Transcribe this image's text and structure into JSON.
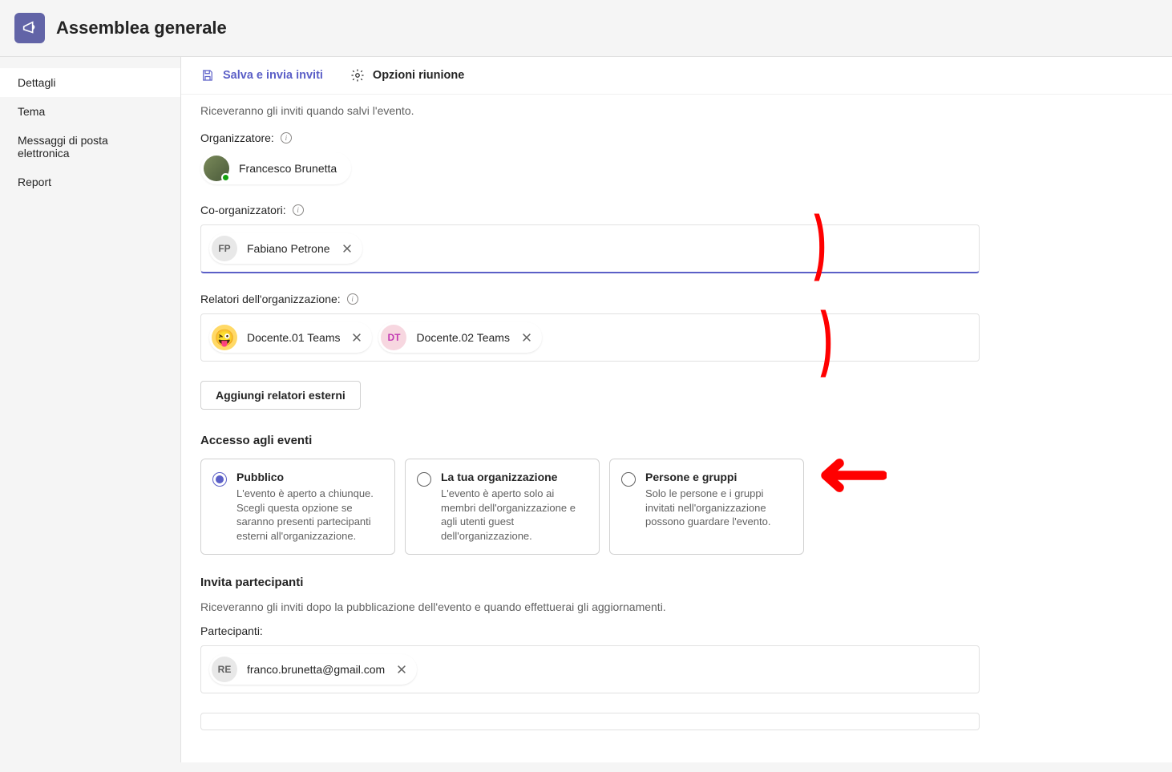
{
  "header": {
    "title": "Assemblea generale"
  },
  "sidebar": {
    "items": [
      {
        "label": "Dettagli",
        "active": true
      },
      {
        "label": "Tema",
        "active": false
      },
      {
        "label": "Messaggi di posta elettronica",
        "active": false
      },
      {
        "label": "Report",
        "active": false
      }
    ]
  },
  "toolbar": {
    "save_label": "Salva e invia inviti",
    "options_label": "Opzioni riunione"
  },
  "content": {
    "invite_info": "Riceveranno gli inviti quando salvi l'evento.",
    "organizer_label": "Organizzatore:",
    "organizer_name": "Francesco Brunetta",
    "coorganizers_label": "Co-organizzatori:",
    "coorganizers": [
      {
        "initials": "FP",
        "name": "Fabiano Petrone",
        "avatar": "fp"
      }
    ],
    "presenters_label": "Relatori dell'organizzazione:",
    "presenters": [
      {
        "initials": "😜",
        "name": "Docente.01 Teams",
        "avatar": "emoji"
      },
      {
        "initials": "DT",
        "name": "Docente.02 Teams",
        "avatar": "dt"
      }
    ],
    "add_external_presenters": "Aggiungi relatori esterni",
    "access_title": "Accesso agli eventi",
    "access_options": [
      {
        "title": "Pubblico",
        "desc": "L'evento è aperto a chiunque. Scegli questa opzione se saranno presenti partecipanti esterni all'organizzazione.",
        "checked": true
      },
      {
        "title": "La tua organizzazione",
        "desc": "L'evento è aperto solo ai membri dell'organizzazione e agli utenti guest dell'organizzazione.",
        "checked": false
      },
      {
        "title": "Persone e gruppi",
        "desc": "Solo le persone e i gruppi invitati nell'organizzazione possono guardare l'evento.",
        "checked": false
      }
    ],
    "invite_participants_title": "Invita partecipanti",
    "invite_participants_sub": "Riceveranno gli inviti dopo la pubblicazione dell'evento e quando effettuerai gli aggiornamenti.",
    "participants_label": "Partecipanti:",
    "participants": [
      {
        "initials": "RE",
        "name": "franco.brunetta@gmail.com",
        "avatar": "re"
      }
    ]
  }
}
